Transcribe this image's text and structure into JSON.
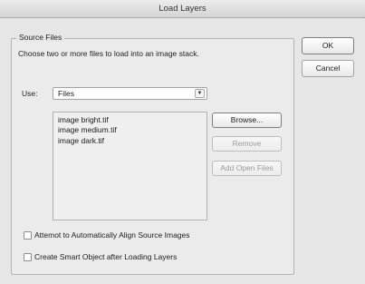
{
  "window": {
    "title": "Load Layers"
  },
  "source_files": {
    "group_title": "Source Files",
    "instruction": "Choose two or more files to load into an image stack.",
    "use_label": "Use:",
    "use_value": "Files",
    "files": [
      "image bright.tif",
      "image medium.tif",
      "image dark.tif"
    ],
    "buttons": {
      "browse": "Browse...",
      "remove": "Remove",
      "add_open_files": "Add Open Files"
    }
  },
  "options": {
    "align": {
      "label": "Attemot to Automatically Align Source Images",
      "checked": false
    },
    "smart_object": {
      "label": "Create Smart Object after Loading Layers",
      "checked": false
    }
  },
  "actions": {
    "ok": "OK",
    "cancel": "Cancel"
  },
  "icons": {
    "dropdown": "chevron-down-icon"
  }
}
